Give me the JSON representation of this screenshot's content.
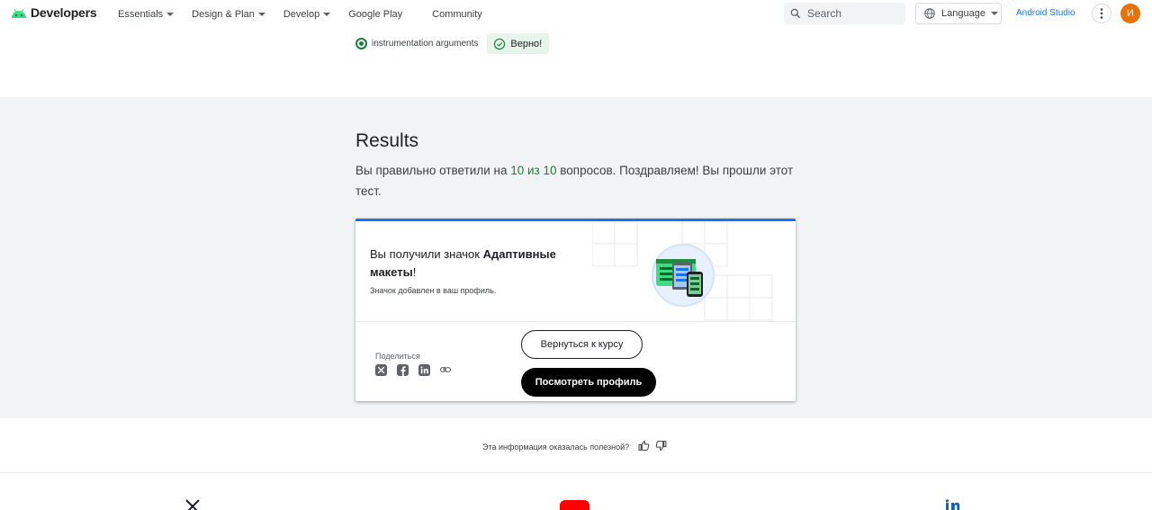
{
  "header": {
    "brand": "Developers",
    "nav": [
      {
        "label": "Essentials",
        "dropdown": true
      },
      {
        "label": "Design & Plan",
        "dropdown": true
      },
      {
        "label": "Develop",
        "dropdown": true
      },
      {
        "label": "Google Play",
        "dropdown": false
      },
      {
        "label": "Community",
        "dropdown": false
      }
    ],
    "search_placeholder": "Search",
    "language_label": "Language",
    "studio_link": "Android Studio",
    "avatar_initial": "И"
  },
  "question": {
    "answer_label": "instrumentation arguments",
    "result_label": "Верно!"
  },
  "results": {
    "title": "Results",
    "text_before": "Вы правильно ответили на ",
    "score": "10 из 10",
    "text_after": " вопросов. Поздравляем! Вы прошли этот тест."
  },
  "badge_card": {
    "title_prefix": "Вы получили значок ",
    "badge_name": "Адаптивные макеты",
    "title_suffix": "!",
    "note": "Значок добавлен в ваш профиль.",
    "share_label": "Поделиться",
    "share_icons": [
      "x-icon",
      "facebook-icon",
      "linkedin-icon",
      "link-icon"
    ],
    "return_button": "Вернуться к курсу",
    "profile_button": "Посмотреть профиль"
  },
  "feedback": {
    "question": "Эта информация оказалась полезной?"
  },
  "colors": {
    "accent": "#1a73e8",
    "success": "#188038",
    "success_bg": "#e6f4ea",
    "band_bg": "#f1f3f4",
    "avatar_bg": "#e8710a"
  }
}
